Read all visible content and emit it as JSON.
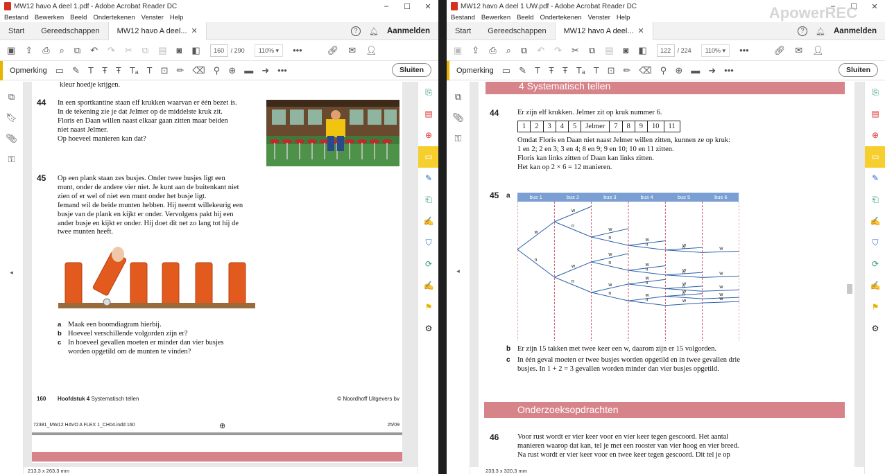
{
  "menu": [
    "Bestand",
    "Bewerken",
    "Beeld",
    "Ondertekenen",
    "Venster",
    "Help"
  ],
  "left": {
    "title": "MW12 havo A deel 1.pdf - Adobe Acrobat Reader DC",
    "tabs": {
      "start": "Start",
      "tools": "Gereedschappen",
      "doc": "MW12 havo A deel..."
    },
    "signin": "Aanmelden",
    "page_current": "160",
    "page_total": "/ 290",
    "zoom": "110%",
    "annot_label": "Opmerking",
    "close": "Sluiten",
    "q44_num": "44",
    "q44_lines": [
      "In een sportkantine staan elf krukken waarvan er één bezet is.",
      "In de tekening zie je dat Jelmer op de middelste kruk zit.",
      "Floris en Daan willen naast elkaar gaan zitten maar beiden",
      "niet naast Jelmer.",
      "Op hoeveel manieren kan dat?"
    ],
    "top_text": "kleur hoedje krijgen.",
    "q45_num": "45",
    "q45_lines": [
      "Op een plank staan zes busjes. Onder twee busjes ligt een",
      "munt, onder de andere vier niet. Je kunt aan de buitenkant niet",
      "zien of er wel of niet een munt onder het busje ligt.",
      "Iemand wil de beide munten hebben. Hij neemt willekeurig een",
      "busje van de plank en kijkt er onder. Vervolgens pakt hij een",
      "ander busje en kijkt er onder. Hij doet dit net zo lang tot hij de",
      "twee munten heeft."
    ],
    "parts": [
      {
        "l": "a",
        "t": "Maak een boomdiagram hierbij."
      },
      {
        "l": "b",
        "t": "Hoeveel verschillende volgorden zijn er?"
      },
      {
        "l": "c",
        "t": "In hoeveel gevallen moeten er minder dan vier busjes"
      },
      {
        "l": "",
        "t": "worden opgetild om de munten te vinden?"
      }
    ],
    "footer_page": "160",
    "footer_chapter_bold": "Hoofdstuk 4",
    "footer_chapter": "Systematisch tellen",
    "footer_publisher": "© Noordhoff Uitgevers bv",
    "slug": "72381_MW12 HAVO A FLEX 1_CH04.indd   160",
    "slug_date": "25/09",
    "dims": "213,3 x 263,3 mm"
  },
  "right": {
    "title": "MW12 havo A deel 1 UW.pdf - Adobe Acrobat Reader DC",
    "tabs": {
      "start": "Start",
      "tools": "Gereedschappen",
      "doc": "MW12 havo A deel..."
    },
    "signin": "Aanmelden",
    "page_current": "122",
    "page_total": "/ 224",
    "zoom": "110%",
    "annot_label": "Opmerking",
    "close": "Sluiten",
    "header": "4  Systematisch tellen",
    "q44_num": "44",
    "q44_intro": "Er zijn elf krukken. Jelmer zit op kruk nummer 6.",
    "seq": [
      "1",
      "2",
      "3",
      "4",
      "5",
      "Jelmer",
      "7",
      "8",
      "9",
      "10",
      "11"
    ],
    "q44_lines": [
      "Omdat Floris en Daan niet naast Jelmer willen zitten, kunnen ze op kruk:",
      "1 en 2; 2 en 3; 3 en 4; 8 en 9; 9 en 10; 10 en 11 zitten.",
      "Floris kan links zitten of Daan kan links zitten.",
      "Het kan op 2 × 6 = 12 manieren."
    ],
    "q45_num": "45",
    "q45_part": "a",
    "bus_labels": [
      "bus 1",
      "bus 2",
      "bus 3",
      "bus 4",
      "bus 5",
      "bus 6"
    ],
    "ans_b_l": "b",
    "ans_b": "Er zijn 15 takken met twee keer een w, daarom zijn er 15 volgorden.",
    "ans_c_l": "c",
    "ans_c": [
      "In één geval moeten er twee busjes worden opgetild en in twee gevallen drie",
      "busjes. In 1 + 2 = 3 gevallen worden minder dan vier busjes opgetild."
    ],
    "section": "Onderzoeksopdrachten",
    "q46_num": "46",
    "q46_lines": [
      "Voor rust wordt er vier keer voor en vier keer tegen gescoord. Het aantal",
      "manieren waarop dat kan, tel je met een rooster van vier hoog en vier breed.",
      "Na rust wordt er vier keer voor en twee keer tegen gescoord. Dit tel je op"
    ],
    "dims": "233,3 x 320,3 mm"
  },
  "watermark": "ApowerREC"
}
